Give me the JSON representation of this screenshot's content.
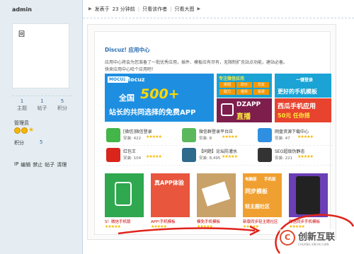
{
  "sidebar": {
    "username": "admin",
    "avatar_glyph": "回",
    "stats": [
      {
        "num": "1",
        "label": "主题"
      },
      {
        "num": "1",
        "label": "帖子"
      },
      {
        "num": "5",
        "label": "积分"
      }
    ],
    "group": "管理员",
    "credit_label": "积分",
    "credit_value": "5",
    "actions": [
      "IP",
      "编辑",
      "禁止",
      "帖子",
      "清理"
    ]
  },
  "infobar": {
    "posted": "发表于",
    "time": "23 分钟前",
    "only_author": "只看该作者",
    "only_big": "只看大图"
  },
  "appcenter": {
    "title": "Discuz! 应用中心",
    "desc1": "应用中心将会为您准备了一批优秀应用，插件、模板应有尽有，无限制扩充站点功能，建站必备。",
    "desc2": "快来应用中心哈个应用吧！"
  },
  "banners": {
    "mocuz_badge": "MOCUZ",
    "mocuz_name": "Mocuz",
    "quanguo": "全国",
    "big": "500+",
    "tagline": "站长的共同选择的免费APP",
    "b2_title": "专注微信应用",
    "b2_grid": [
      "拼团",
      "砍价",
      "交友",
      "助力",
      "摇奖",
      "投票"
    ],
    "b3_t1": "DZAPP",
    "b3_t2": "直播",
    "b4_t1": "一键登录",
    "b4_t2": "更好的手机模板",
    "b5_t1": "西瓜手机应用",
    "b5_t2": "50元 任你搭"
  },
  "apps": [
    [
      {
        "name": "[微信]微信登录",
        "inst": "安装: 422",
        "color": "#44b549"
      },
      {
        "name": "微信群登录平台应",
        "inst": "安装: 8",
        "color": "#5cb85c"
      },
      {
        "name": "网盘资源下载中心",
        "inst": "安装: 47",
        "color": "#2f8fe0"
      }
    ],
    [
      {
        "name": "红包王",
        "inst": "安装: 104",
        "color": "#d9251c"
      },
      {
        "name": "【同题】论坛防灌水",
        "inst": "安装: 8,495",
        "color": "#2d6a8c"
      },
      {
        "name": "SEO超级伪静态",
        "inst": "安装: 221",
        "color": "#333333"
      }
    ]
  ],
  "app_stars": "★★★★★",
  "tiles": [
    {
      "label": "S！微信手机版",
      "bg": "#2fa84f",
      "txt": "S！微信手机版"
    },
    {
      "label": "APP!手机模板",
      "bg": "#e8563e",
      "txt": "真APP体验"
    },
    {
      "label": "模免手机模板",
      "bg": "#c9a26a",
      "txt": ""
    },
    {
      "label": "新版同步轻主题社区",
      "bg": "#f0a030",
      "txt": "同步模板"
    },
    {
      "label": "微信同步手机模板",
      "bg": "#6b3fb5",
      "txt": ""
    }
  ],
  "tile_extra": {
    "t3_top": "电脑版",
    "t3_mid": "手机版",
    "t3_bot": "轻主题社区"
  },
  "tile_stars": "★★★★★",
  "watermark": {
    "name": "创新互联",
    "sub": "CHUANG XIN HU LIAN"
  },
  "colors": {
    "sidebar_bg": "#e5edf2",
    "link": "#369",
    "accent_blue": "#1e8fe0",
    "arrow_red": "#e0231c"
  }
}
